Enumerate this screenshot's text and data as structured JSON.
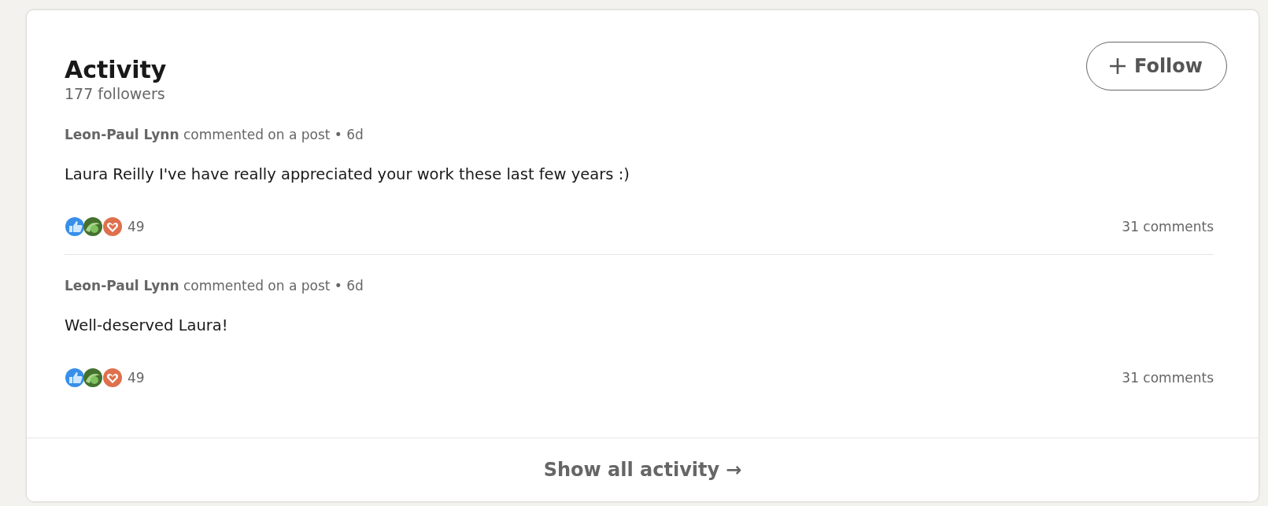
{
  "section": {
    "title": "Activity",
    "followers": "177 followers"
  },
  "follow_button": {
    "label": "Follow"
  },
  "posts": [
    {
      "header": "**Leon-Paul Lynn** commented on a post • 6d",
      "text": "Laura Reilly I've have really appreciated your work these last few years :)",
      "reaction_count": "49",
      "comments": "31 comments"
    },
    {
      "header": "**Leon-Paul Lynn** commented on a post • 6d",
      "text": "Well-deserved Laura!",
      "reaction_count": "49",
      "comments": "31 comments"
    }
  ],
  "footer": {
    "label": "Show all activity",
    "arrow": "→"
  }
}
